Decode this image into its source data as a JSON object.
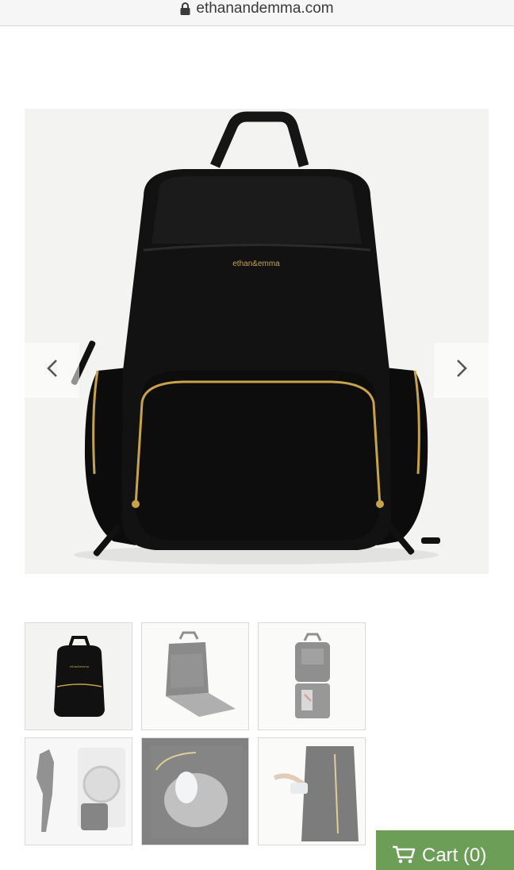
{
  "browser": {
    "url": "ethanandemma.com",
    "icons": {
      "lock": "lock-icon"
    }
  },
  "gallery": {
    "main_image_alt": "ethan&emma",
    "brand_logo": "ethan&emma",
    "prev_icon": "chevron-left-icon",
    "next_icon": "chevron-right-icon",
    "thumbnails": [
      {
        "name": "thumbnail-front-view",
        "selected": true
      },
      {
        "name": "thumbnail-open-view"
      },
      {
        "name": "thumbnail-interior-view"
      },
      {
        "name": "thumbnail-laundry-scene"
      },
      {
        "name": "thumbnail-bottle-pocket"
      },
      {
        "name": "thumbnail-side-pocket"
      }
    ]
  },
  "cart": {
    "label": "Cart (0)",
    "icon": "cart-icon"
  },
  "colors": {
    "accent_green": "#6c9e57",
    "bag_black": "#111111",
    "zipper_gold": "#c9a349"
  }
}
